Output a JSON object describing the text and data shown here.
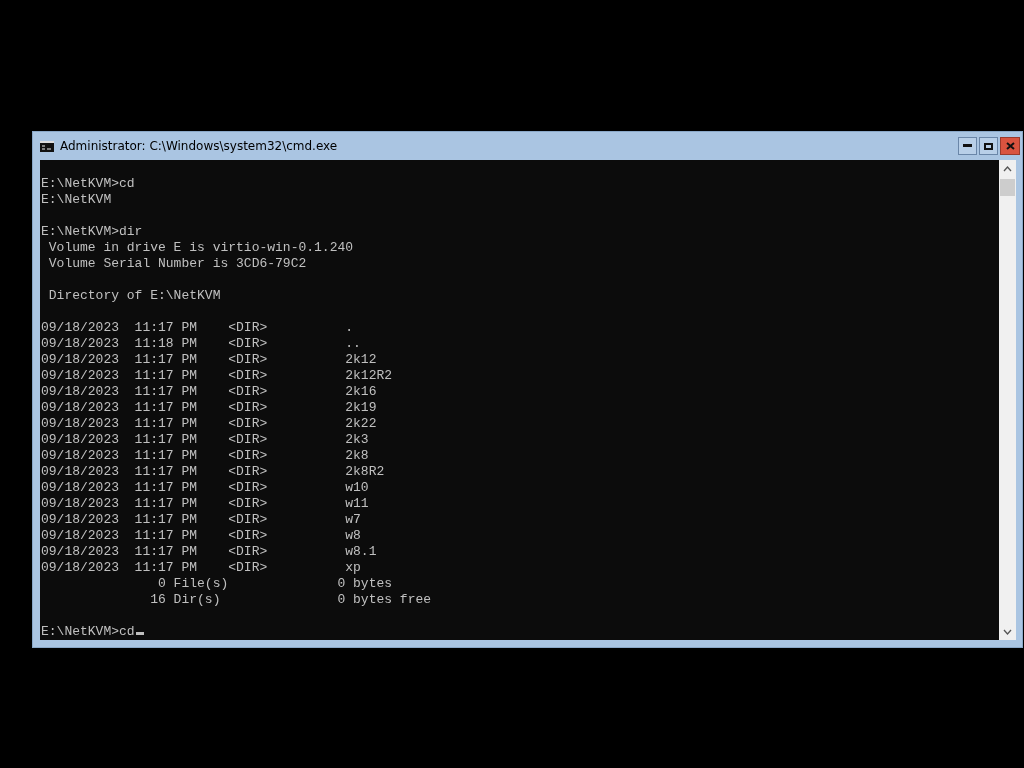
{
  "window": {
    "title": "Administrator: C:\\Windows\\system32\\cmd.exe"
  },
  "console": {
    "blocks": [
      [
        "E:\\NetKVM>cd",
        "E:\\NetKVM"
      ],
      [
        "E:\\NetKVM>dir",
        " Volume in drive E is virtio-win-0.1.240",
        " Volume Serial Number is 3CD6-79C2"
      ],
      [
        " Directory of E:\\NetKVM"
      ],
      [
        "09/18/2023  11:17 PM    <DIR>          .",
        "09/18/2023  11:18 PM    <DIR>          ..",
        "09/18/2023  11:17 PM    <DIR>          2k12",
        "09/18/2023  11:17 PM    <DIR>          2k12R2",
        "09/18/2023  11:17 PM    <DIR>          2k16",
        "09/18/2023  11:17 PM    <DIR>          2k19",
        "09/18/2023  11:17 PM    <DIR>          2k22",
        "09/18/2023  11:17 PM    <DIR>          2k3",
        "09/18/2023  11:17 PM    <DIR>          2k8",
        "09/18/2023  11:17 PM    <DIR>          2k8R2",
        "09/18/2023  11:17 PM    <DIR>          w10",
        "09/18/2023  11:17 PM    <DIR>          w11",
        "09/18/2023  11:17 PM    <DIR>          w7",
        "09/18/2023  11:17 PM    <DIR>          w8",
        "09/18/2023  11:17 PM    <DIR>          w8.1",
        "09/18/2023  11:17 PM    <DIR>          xp",
        "               0 File(s)              0 bytes",
        "              16 Dir(s)               0 bytes free"
      ]
    ],
    "input_line": "E:\\NetKVM>cd"
  }
}
